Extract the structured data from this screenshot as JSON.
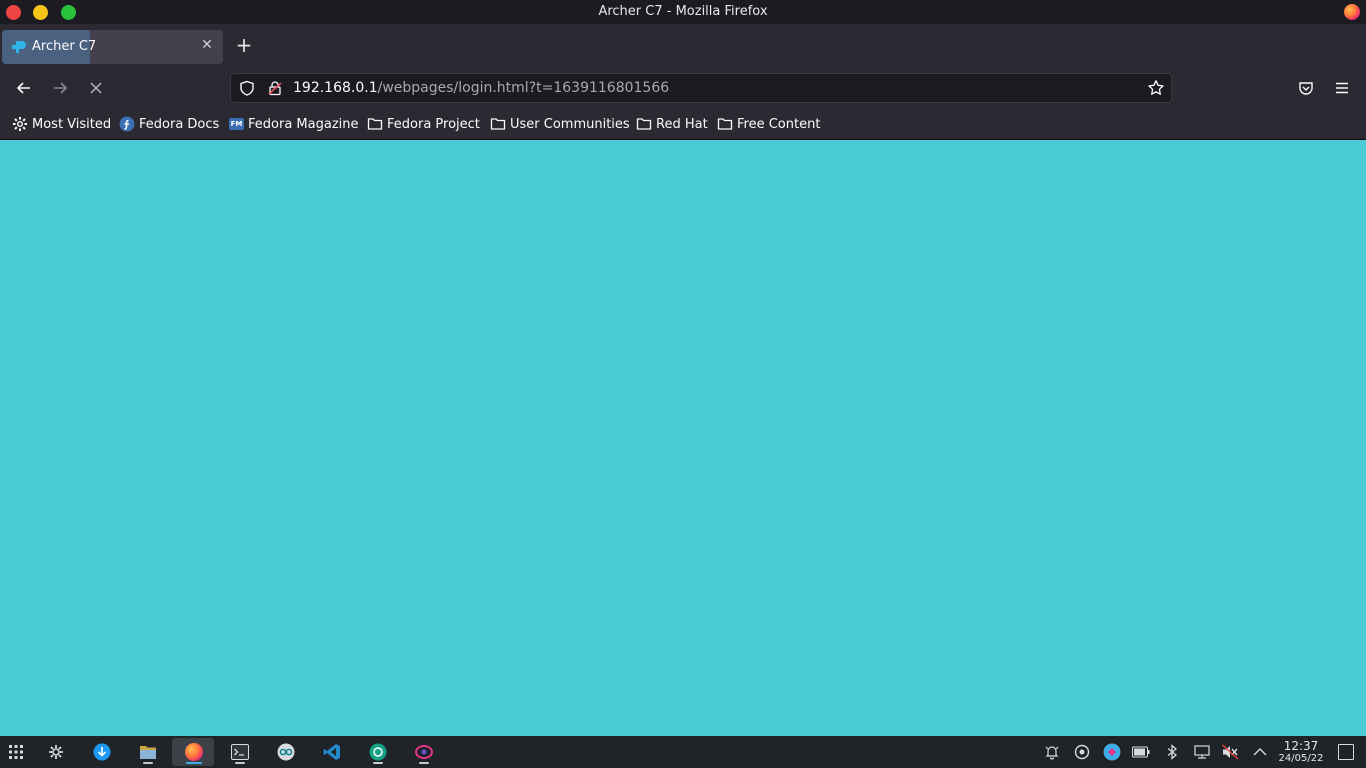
{
  "window": {
    "title": "Archer C7 - Mozilla Firefox"
  },
  "tabs": [
    {
      "title": "Archer C7",
      "active": true,
      "loading": true
    }
  ],
  "newtab_symbol": "+",
  "navigation": {
    "back_symbol": "←",
    "forward_symbol": "→",
    "stop_symbol": "✕"
  },
  "urlbar": {
    "host": "192.168.0.1",
    "path": "/webpages/login.html?t=1639116801566"
  },
  "bookmarks": [
    {
      "label": "Most Visited",
      "icon": "gear-icon"
    },
    {
      "label": "Fedora Docs",
      "icon": "fedora-icon"
    },
    {
      "label": "Fedora Magazine",
      "icon": "fedora-magazine-icon",
      "badge": "FM"
    },
    {
      "label": "Fedora Project",
      "icon": "folder-icon"
    },
    {
      "label": "User Communities",
      "icon": "folder-icon"
    },
    {
      "label": "Red Hat",
      "icon": "folder-icon"
    },
    {
      "label": "Free Content",
      "icon": "folder-icon"
    }
  ],
  "page": {
    "background_color": "#4bcbd6"
  },
  "taskbar": {
    "apps": [
      {
        "name": "app-launcher-icon"
      },
      {
        "name": "system-settings-icon"
      },
      {
        "name": "discover-icon"
      },
      {
        "name": "file-manager-icon"
      },
      {
        "name": "firefox-icon",
        "active": true
      },
      {
        "name": "terminal-icon"
      },
      {
        "name": "arduino-icon"
      },
      {
        "name": "vscode-icon"
      },
      {
        "name": "app-green-icon"
      },
      {
        "name": "app-pink-icon"
      }
    ],
    "tray": [
      "notifications-icon",
      "updates-icon",
      "app-tray-icon",
      "battery-icon",
      "bluetooth-icon",
      "network-icon",
      "volume-muted-icon",
      "tray-expand-icon"
    ],
    "clock": {
      "time": "12:37",
      "date": "24/05/22"
    }
  }
}
